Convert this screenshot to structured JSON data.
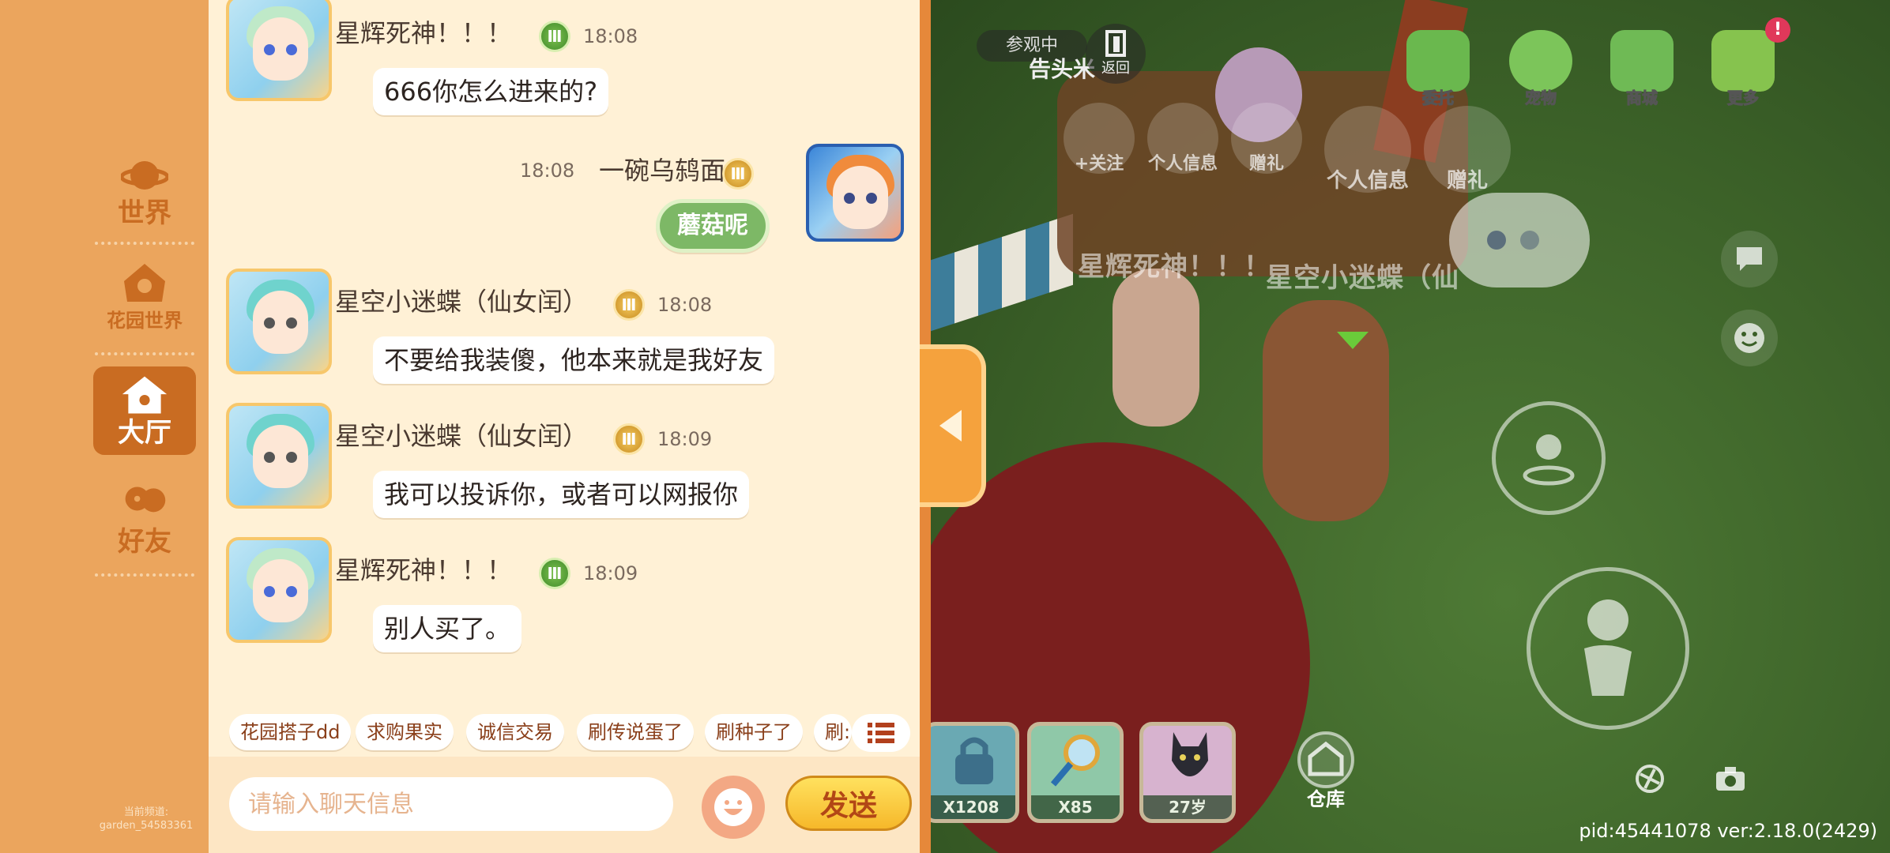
{
  "nav": {
    "items": [
      {
        "label": "世界",
        "icon": "planet-icon"
      },
      {
        "label": "花园世界",
        "icon": "flower-icon"
      },
      {
        "label": "大厅",
        "icon": "house-icon",
        "active": true
      },
      {
        "label": "好友",
        "icon": "friends-icon"
      }
    ],
    "channel_label": "当前频道:",
    "channel_value": "garden_54583361"
  },
  "messages": [
    {
      "sender": "星辉死神！！！",
      "badge": "green",
      "time": "18:08",
      "text": "666你怎么进来的?",
      "self": false
    },
    {
      "sender": "一碗乌鸫面",
      "badge": "gold",
      "time": "18:08",
      "text": "蘑菇呢",
      "self": true
    },
    {
      "sender": "星空小迷蝶（仙女闰）",
      "badge": "gold",
      "time": "18:08",
      "text": "不要给我装傻，他本来就是我好友",
      "self": false
    },
    {
      "sender": "星空小迷蝶（仙女闰）",
      "badge": "gold",
      "time": "18:09",
      "text": "我可以投诉你，或者可以网报你",
      "self": false
    },
    {
      "sender": "星辉死神！！！",
      "badge": "green",
      "time": "18:09",
      "text": "别人买了。",
      "self": false
    }
  ],
  "quick_phrases": [
    "花园搭子dd",
    "求购果实",
    "诚信交易",
    "刷传说蛋了",
    "刷种子了",
    "刷:"
  ],
  "input": {
    "placeholder": "请输入聊天信息",
    "value": ""
  },
  "send_label": "发送",
  "scene": {
    "visiting_label": "参观中",
    "return_label": "返回",
    "top_icons": [
      {
        "label": "委托",
        "icon": "clipboard-icon"
      },
      {
        "label": "宠物",
        "icon": "paw-icon"
      },
      {
        "label": "商城",
        "icon": "shop-icon"
      },
      {
        "label": "更多",
        "icon": "more-icon"
      }
    ],
    "more_notice": "!",
    "player_actions": [
      "+关注",
      "个人信息",
      "赠礼"
    ],
    "player_actions_2": [
      "个人信息",
      "赠礼"
    ],
    "player_name_1": "星辉死神！！！",
    "player_name_2": "星空小迷蝶（仙",
    "sign_text": "告头米",
    "slots": [
      {
        "count": "X1208",
        "icon": "lock-icon"
      },
      {
        "count": "X85",
        "icon": "magnifier-icon"
      },
      {
        "count": "27岁",
        "icon": "cat-icon"
      }
    ],
    "warehouse_label": "仓库",
    "pid_text": "pid:45441078 ver:2.18.0(2429)"
  },
  "colors": {
    "nav_bg": "#eba55d",
    "nav_active": "#c96c22",
    "chat_bg": "#fff1d6",
    "send_btn": "#f6b82a",
    "self_bubble": "#7db866"
  }
}
